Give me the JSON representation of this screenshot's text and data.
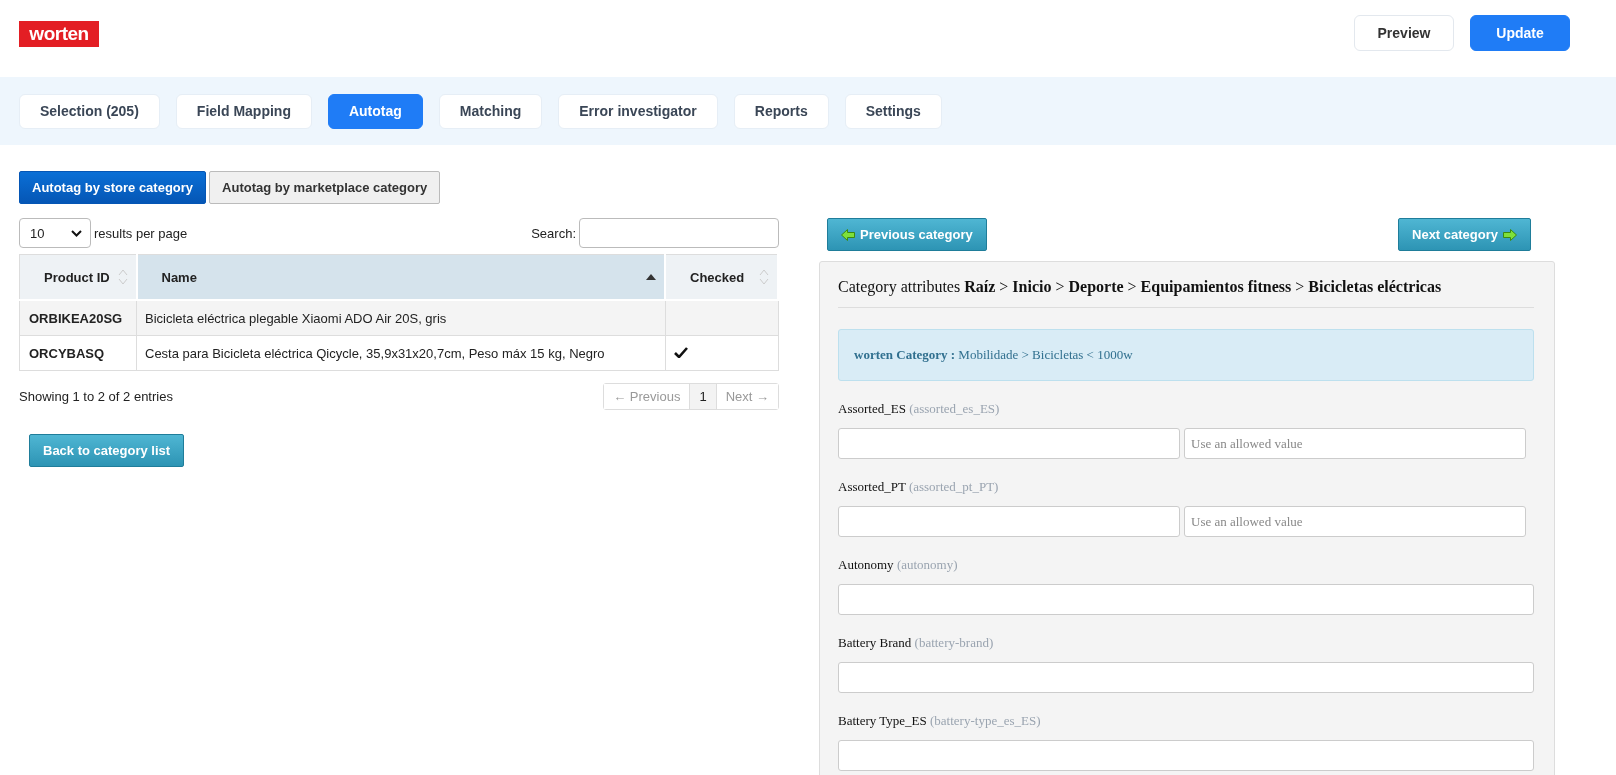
{
  "header": {
    "logo": "worten",
    "buttons": [
      {
        "label": "Preview",
        "kind": "default"
      },
      {
        "label": "Update",
        "kind": "primary"
      }
    ]
  },
  "tabs": [
    {
      "label": "Selection (205)",
      "selected": false
    },
    {
      "label": "Field Mapping",
      "selected": false
    },
    {
      "label": "Autotag",
      "selected": true
    },
    {
      "label": "Matching",
      "selected": false
    },
    {
      "label": "Error investigator",
      "selected": false
    },
    {
      "label": "Reports",
      "selected": false
    },
    {
      "label": "Settings",
      "selected": false
    }
  ],
  "mode_buttons": [
    {
      "label": "Autotag by store category",
      "selected": true
    },
    {
      "label": "Autotag by marketplace category",
      "selected": false
    }
  ],
  "table_controls": {
    "page_size": "10",
    "page_size_label": "results per page",
    "search_label": "Search:"
  },
  "table": {
    "columns": [
      {
        "label": "Product ID",
        "sorted": false
      },
      {
        "label": "Name",
        "sorted": true
      },
      {
        "label": "Checked",
        "sorted": false
      }
    ],
    "rows": [
      {
        "product_id": "ORBIKEA20SG",
        "name": "Bicicleta eléctrica plegable Xiaomi ADO Air 20S, gris",
        "checked": false
      },
      {
        "product_id": "ORCYBASQ",
        "name": "Cesta para Bicicleta eléctrica Qicycle, 35,9x31x20,7cm, Peso máx 15 kg, Negro",
        "checked": true
      }
    ]
  },
  "table_info": "Showing 1 to 2 of 2 entries",
  "pagination": [
    {
      "label": "← Previous",
      "disabled": true,
      "selected": false
    },
    {
      "label": "1",
      "disabled": false,
      "selected": true
    },
    {
      "label": "Next →",
      "disabled": true,
      "selected": false
    }
  ],
  "back_button": "Back to category list",
  "category_nav": {
    "previous": "Previous category",
    "next": "Next category"
  },
  "panel": {
    "title": "Category attributes **Raíz** > **Inicio** > **Deporte** > **Equipamientos fitness** > **Bicicletas eléctricas**",
    "info": "**worten Category :** Mobilidade > Bicicletas < 1000w",
    "fields": [
      {
        "label": "Assorted_ES",
        "key": "(assorted_es_ES)",
        "kind": "dual",
        "placeholder": "Use an allowed value"
      },
      {
        "label": "Assorted_PT",
        "key": "(assorted_pt_PT)",
        "kind": "dual",
        "placeholder": "Use an allowed value"
      },
      {
        "label": "Autonomy",
        "key": "(autonomy)",
        "kind": "single"
      },
      {
        "label": "Battery Brand",
        "key": "(battery-brand)",
        "kind": "single"
      },
      {
        "label": "Battery Type_ES",
        "key": "(battery-type_es_ES)",
        "kind": "single"
      }
    ]
  }
}
